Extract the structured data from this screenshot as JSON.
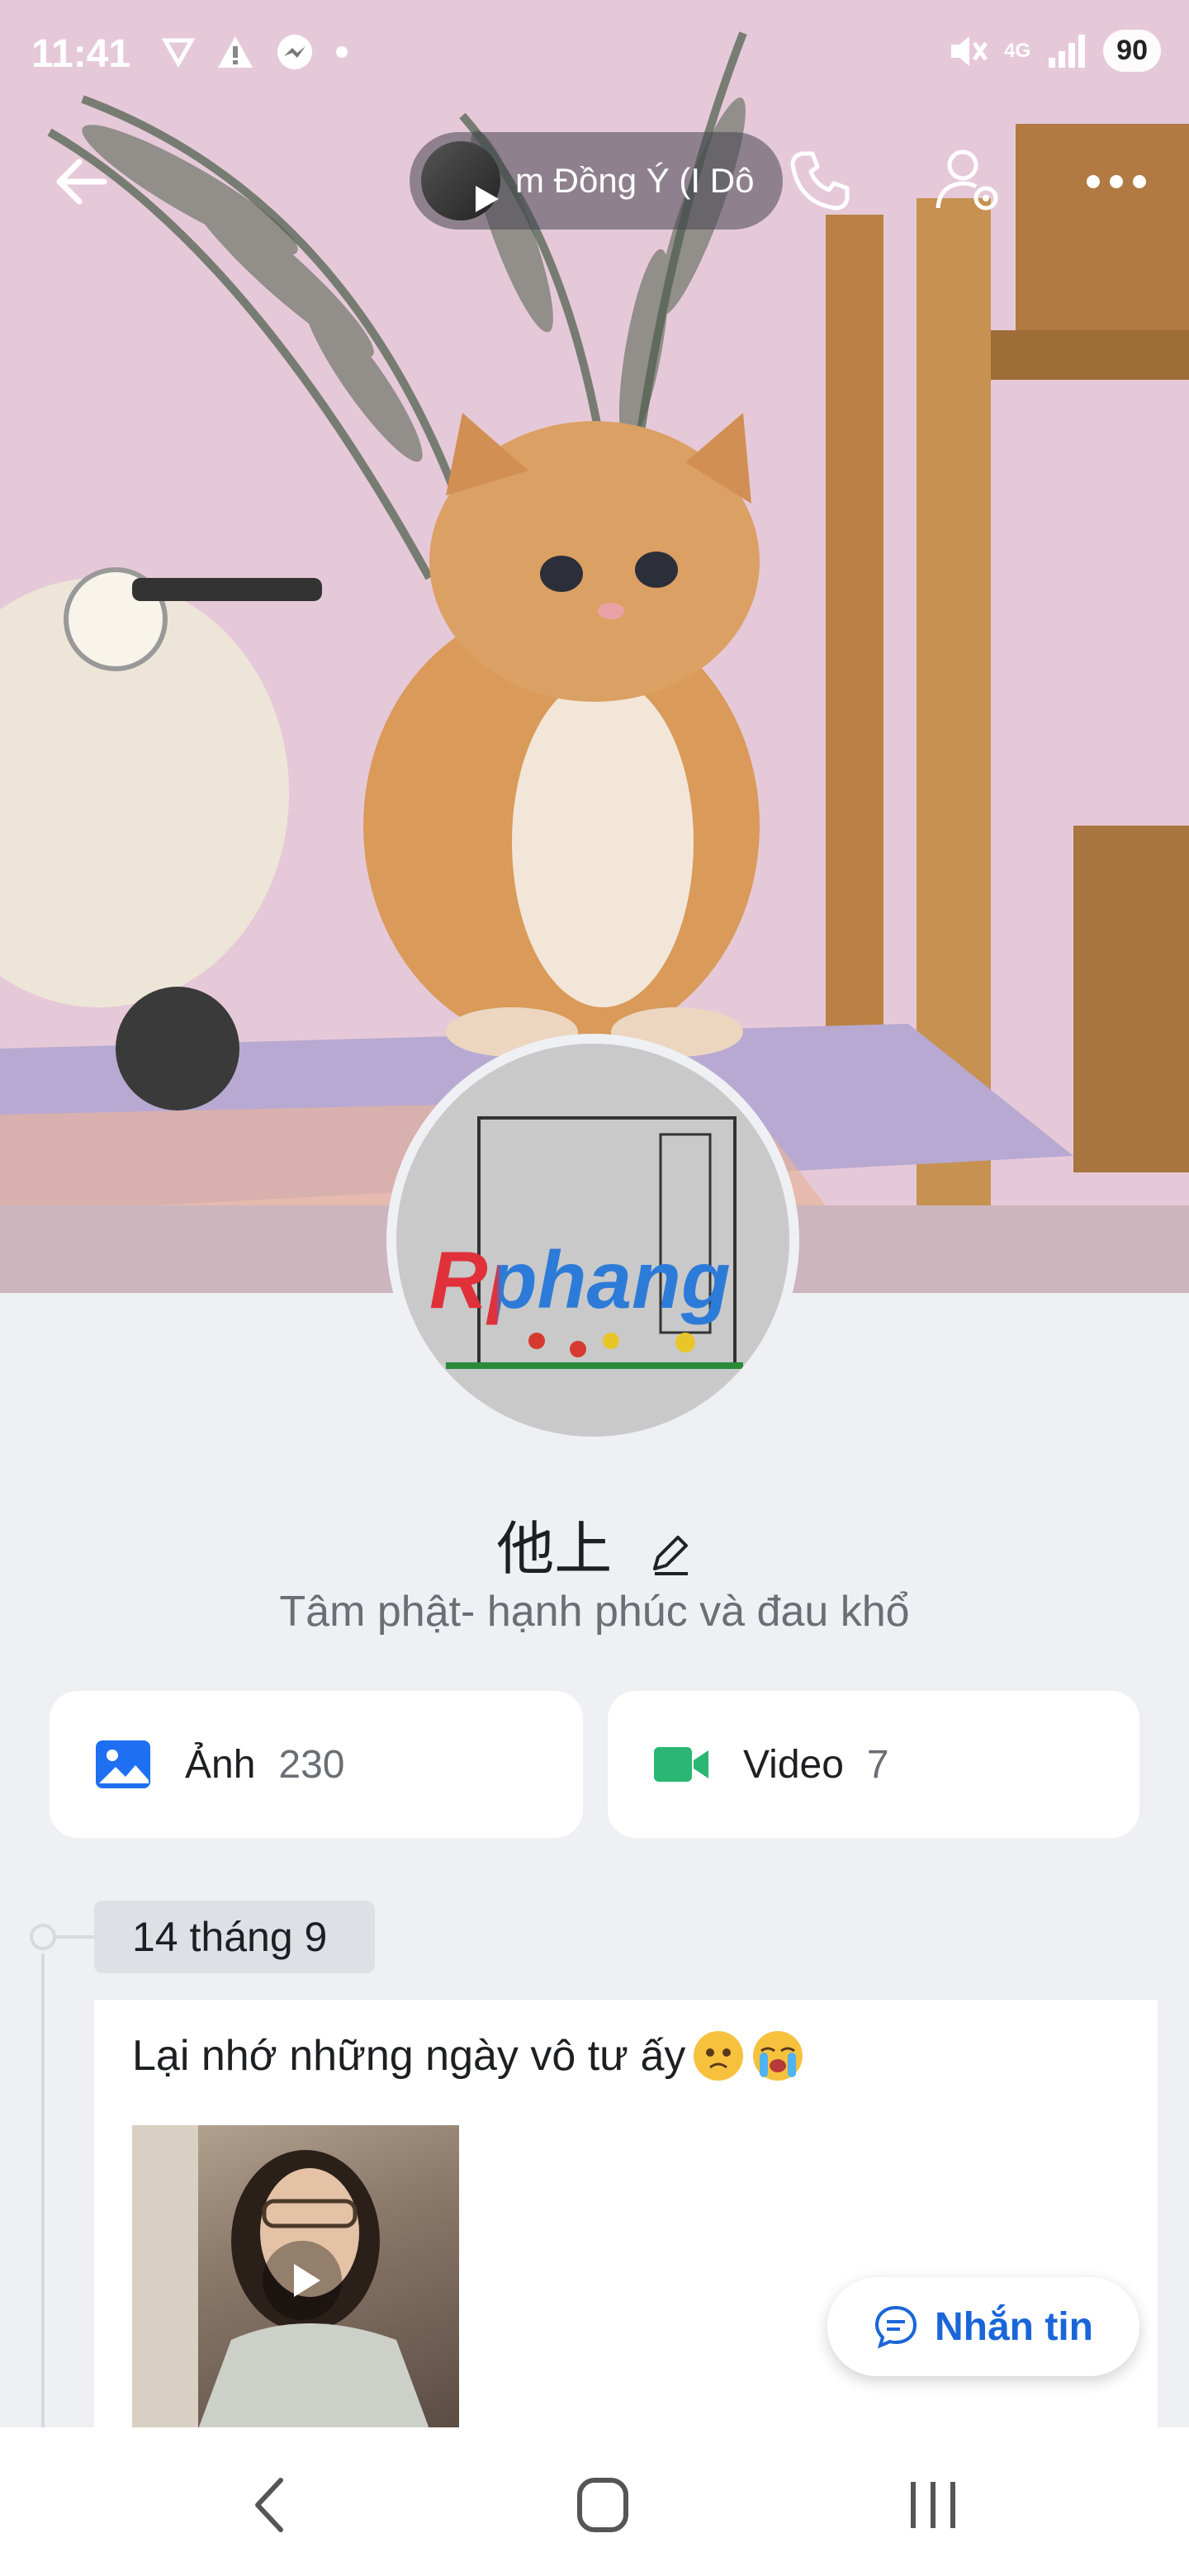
{
  "status_bar": {
    "time": "11:41",
    "battery": "90",
    "network": "4G"
  },
  "header": {
    "group_name": "m Đồng Ý (I Dô"
  },
  "profile": {
    "name": "他上",
    "bio": "Tâm phật- hạnh phúc và đau khổ",
    "avatar_watermark": "Rphang"
  },
  "media": {
    "photos": {
      "label": "Ảnh",
      "count": "230"
    },
    "videos": {
      "label": "Video",
      "count": "7"
    }
  },
  "timeline": {
    "date": "14 tháng 9",
    "post_text": "Lại nhớ những ngày vô tư ấy"
  },
  "message_button": {
    "label": "Nhắn tin"
  },
  "colors": {
    "accent": "#1a66d9",
    "photo_icon": "#1e6ff2",
    "video_icon": "#2bb673"
  }
}
